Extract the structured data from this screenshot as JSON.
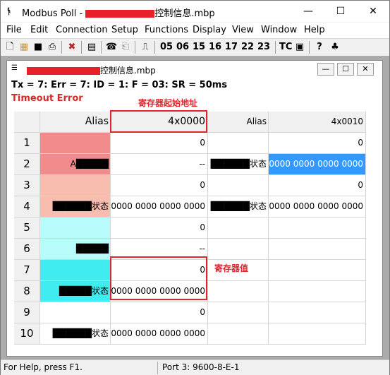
{
  "window": {
    "title_prefix": "Modbus Poll - ",
    "title_suffix": "控制信息.mbp",
    "minimize": "—",
    "maximize": "☐",
    "close": "✕"
  },
  "menu": [
    "File",
    "Edit",
    "Connection",
    "Setup",
    "Functions",
    "Display",
    "View",
    "Window",
    "Help"
  ],
  "toolbar": {
    "function_codes": [
      "05",
      "06",
      "15",
      "16",
      "17",
      "22",
      "23"
    ],
    "tc_label": "TC",
    "help_glyph": "?",
    "about_glyph": "♣"
  },
  "child": {
    "title_suffix": "控制信息.mbp",
    "status_line": "Tx = 7: Err = 7: ID = 1: F = 03: SR = 50ms",
    "error_line": "Timeout Error"
  },
  "grid": {
    "headers": {
      "alias1": "Alias",
      "addr1": "4x0000",
      "alias2": "Alias",
      "addr2": "4x0010"
    },
    "rows": [
      {
        "num": "1",
        "alias1": "",
        "val1": "0",
        "alias2": "",
        "val2": "0"
      },
      {
        "num": "2",
        "alias1": "A█████",
        "val1": "--",
        "alias2": "██████状态",
        "val2": "0000 0000 0000 0000"
      },
      {
        "num": "3",
        "alias1": "",
        "val1": "0",
        "alias2": "",
        "val2": "0"
      },
      {
        "num": "4",
        "alias1": "██████状态",
        "val1": "0000 0000 0000 0000",
        "alias2": "██████状态",
        "val2": "0000 0000 0000 0000"
      },
      {
        "num": "5",
        "alias1": "",
        "val1": "0",
        "alias2": "",
        "val2": ""
      },
      {
        "num": "6",
        "alias1": "█████",
        "val1": "--",
        "alias2": "",
        "val2": ""
      },
      {
        "num": "7",
        "alias1": "",
        "val1": "0",
        "alias2": "",
        "val2": ""
      },
      {
        "num": "8",
        "alias1": "█████状态",
        "val1": "0000 0000 0000 0000",
        "alias2": "",
        "val2": ""
      },
      {
        "num": "9",
        "alias1": "",
        "val1": "0",
        "alias2": "",
        "val2": ""
      },
      {
        "num": "10",
        "alias1": "██████状态",
        "val1": "0000 0000 0000 0000",
        "alias2": "",
        "val2": ""
      }
    ],
    "alias_colors": [
      "#f28c8c",
      "#f28c8c",
      "#f9bdb0",
      "#f9bdb0",
      "#b8fbfb",
      "#b8fbfb",
      "#40ecf0",
      "#40ecf0",
      "#ffffff",
      "#ffffff"
    ]
  },
  "annotations": {
    "start_address": "寄存器起始地址",
    "register_value": "寄存器值"
  },
  "statusbar": {
    "help": "For Help, press F1.",
    "port": "Port 3: 9600-8-E-1"
  },
  "colors": {
    "selected": "#3399ff",
    "annotation": "#e0262c"
  }
}
